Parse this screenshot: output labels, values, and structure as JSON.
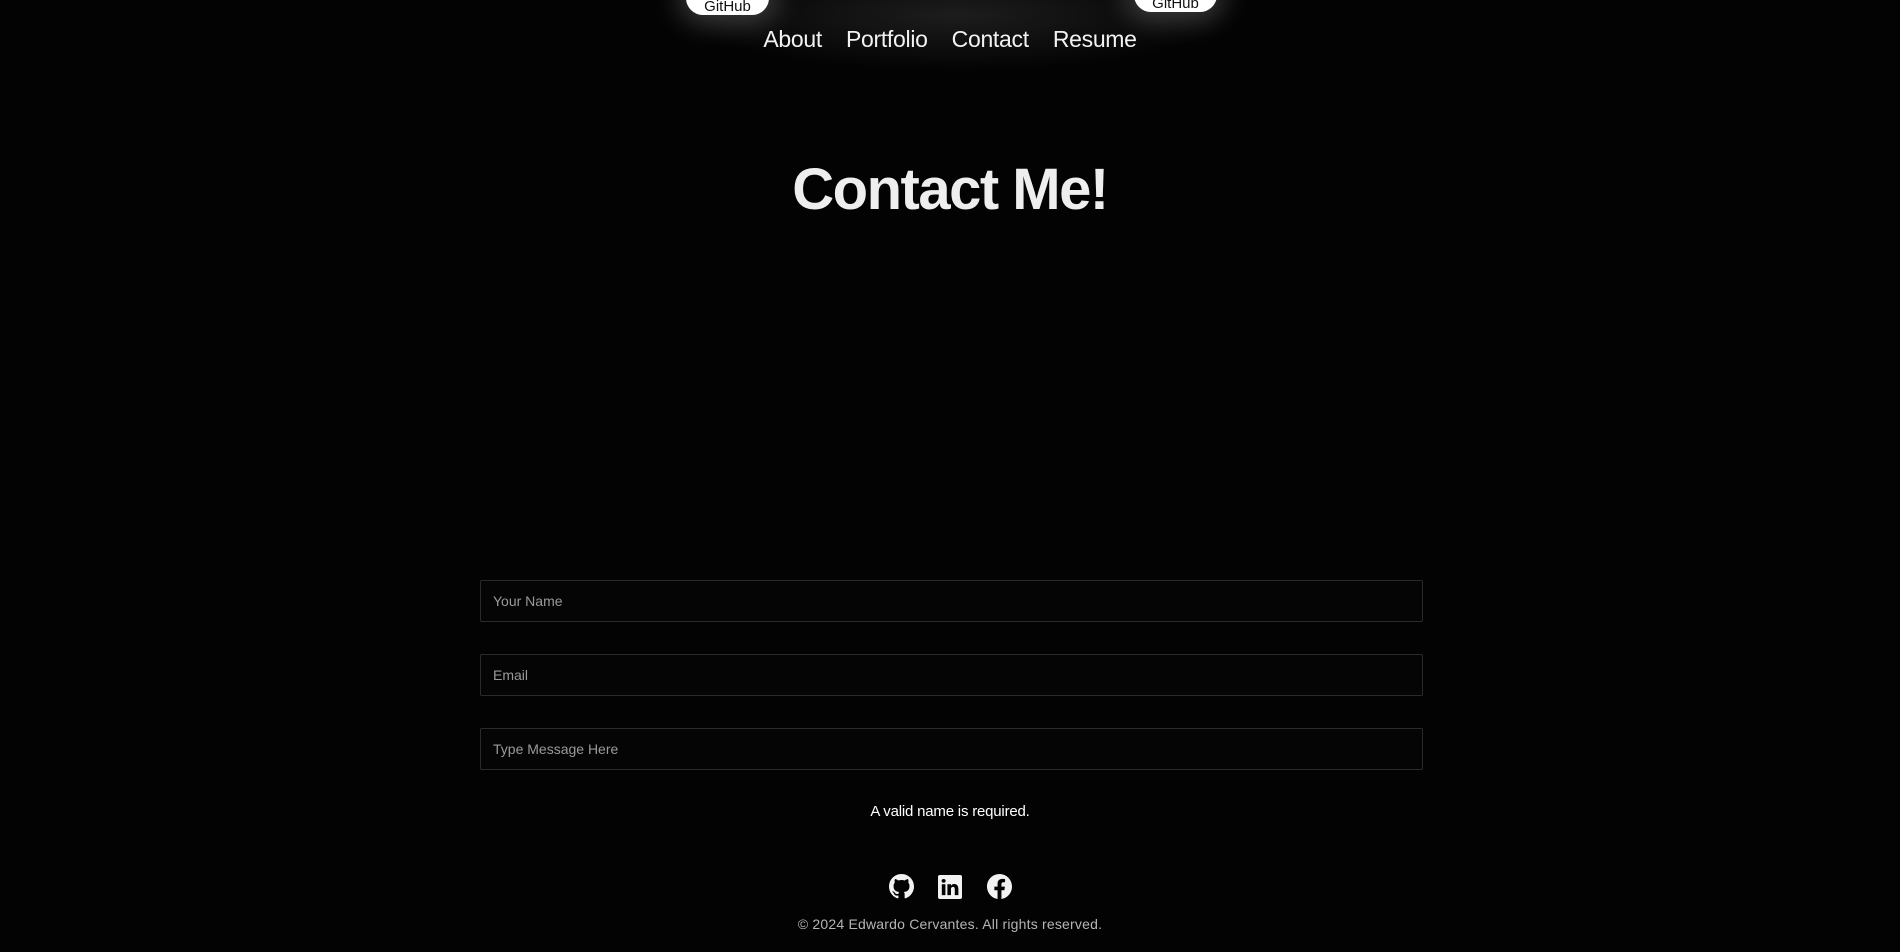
{
  "header": {
    "pill_left_label": "GitHub",
    "pill_right_label": "GitHub",
    "nav": [
      {
        "label": "About"
      },
      {
        "label": "Portfolio"
      },
      {
        "label": "Contact"
      },
      {
        "label": "Resume"
      }
    ]
  },
  "main": {
    "title": "Contact Me!",
    "form": {
      "name_placeholder": "Your Name",
      "email_placeholder": "Email",
      "message_placeholder": "Type Message Here",
      "error_text": "A valid name is required."
    }
  },
  "footer": {
    "social_icons": [
      "github-icon",
      "linkedin-icon",
      "facebook-icon"
    ],
    "copyright": "© 2024 Edwardo Cervantes. All rights reserved."
  },
  "colors": {
    "background": "#030303",
    "text": "#eeeeee",
    "field_border": "#2a2a2a",
    "pill": "#ffffff"
  }
}
